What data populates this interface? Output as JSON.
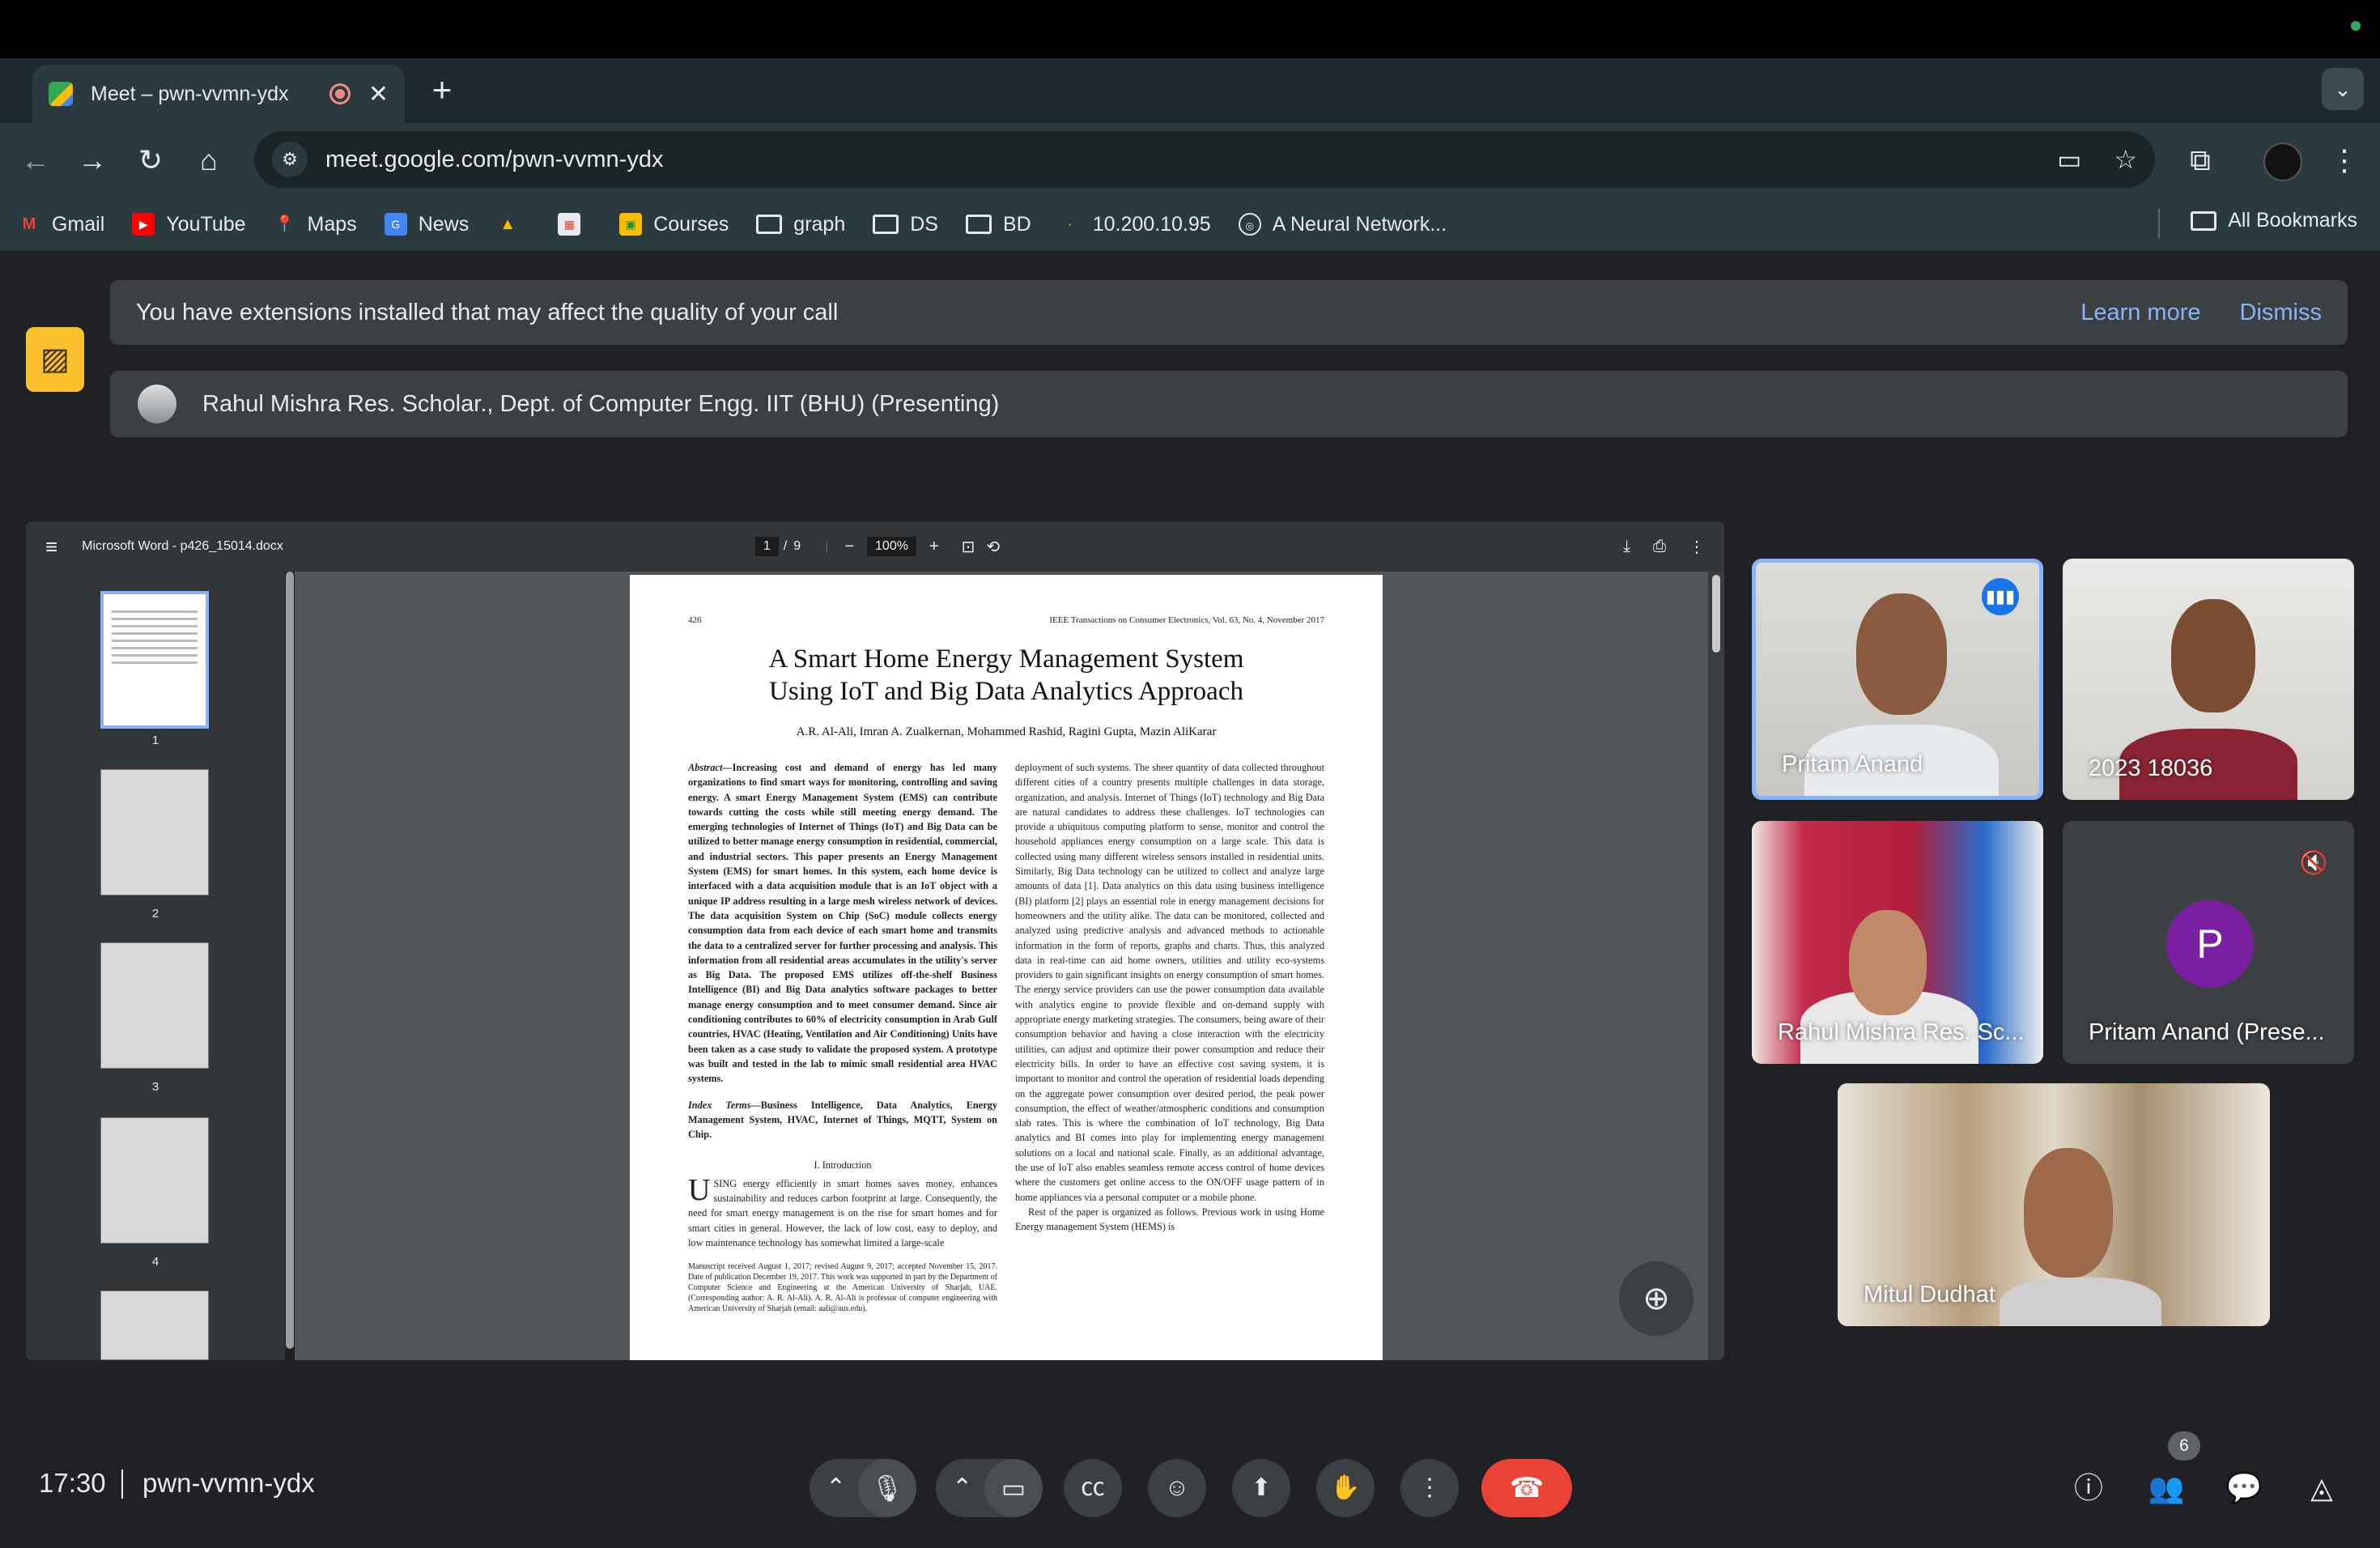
{
  "browser": {
    "tab_title": "Meet – pwn-vvmn-ydx",
    "url": "meet.google.com/pwn-vvmn-ydx",
    "bookmarks": [
      {
        "label": "Gmail",
        "icon": "gmail-icon"
      },
      {
        "label": "YouTube",
        "icon": "youtube-icon"
      },
      {
        "label": "Maps",
        "icon": "maps-icon"
      },
      {
        "label": "News",
        "icon": "news-icon"
      },
      {
        "label": "",
        "icon": "drive-icon"
      },
      {
        "label": "",
        "icon": "calendar-icon"
      },
      {
        "label": "Courses",
        "icon": "classroom-icon"
      },
      {
        "label": "graph",
        "icon": "folder-icon"
      },
      {
        "label": "DS",
        "icon": "folder-icon"
      },
      {
        "label": "BD",
        "icon": "folder-icon"
      },
      {
        "label": "10.200.10.95",
        "icon": "site-icon"
      },
      {
        "label": "A Neural Network...",
        "icon": "site-icon"
      }
    ],
    "all_bookmarks": "All Bookmarks"
  },
  "banners": {
    "extension_message": "You have extensions installed that may affect the quality of your call",
    "learn_more": "Learn more",
    "dismiss": "Dismiss",
    "presenting": "Rahul Mishra Res. Scholar., Dept. of Computer Engg. IIT (BHU) (Presenting)"
  },
  "pdf": {
    "file_title": "Microsoft Word - p426_15014.docx",
    "page_current": "1",
    "page_sep": "/",
    "page_total": "9",
    "zoom": "100%",
    "thumb_numbers": [
      "1",
      "2",
      "3",
      "4"
    ],
    "header_left": "426",
    "header_right": "IEEE Transactions on Consumer Electronics, Vol. 63, No. 4, November 2017",
    "title_line1": "A Smart Home Energy Management System",
    "title_line2": "Using IoT and Big Data Analytics Approach",
    "authors": "A.R. Al-Ali, Imran A. Zualkernan, Mohammed Rashid, Ragini Gupta, Mazin AliKarar",
    "abstract_label": "Abstract—",
    "abstract": "Increasing cost and demand of energy has led many organizations to find smart ways for monitoring, controlling and saving energy. A smart Energy Management System (EMS) can contribute towards cutting the costs while still meeting energy demand. The emerging technologies of Internet of Things (IoT) and Big Data can be utilized to better manage energy consumption in residential, commercial, and industrial sectors. This paper presents an Energy Management System (EMS) for smart homes. In this system, each home device is interfaced with a data acquisition module that is an IoT object with a unique IP address resulting in a large mesh wireless network of devices. The data acquisition System on Chip (SoC) module collects energy consumption data from each device of each smart home and transmits the data to a centralized server for further processing and analysis. This information from all residential areas accumulates in the utility's server as Big Data. The proposed EMS utilizes off-the-shelf Business Intelligence (BI) and Big Data analytics software packages to better manage energy consumption and to meet consumer demand. Since air conditioning contributes to 60% of electricity consumption in Arab Gulf countries, HVAC (Heating, Ventilation and Air Conditioning) Units have been taken as a case study to validate the proposed system. A prototype was built and tested in the lab to mimic small residential area HVAC systems.",
    "index_label": "Index Terms—",
    "index_terms": "Business Intelligence, Data Analytics, Energy Management System, HVAC, Internet of Things, MQTT, System on Chip.",
    "section_heading": "I. Introduction",
    "intro_dropcap": "U",
    "intro": "SING energy efficiently in smart homes saves money, enhances sustainability and reduces carbon footprint at large. Consequently, the need for smart energy management is on the rise for smart homes and for smart cities in general. However, the lack of low cost, easy to deploy, and low maintenance technology has somewhat limited a large-scale",
    "footnote": "Manuscript received August 1, 2017; revised August 9, 2017; accepted November 15, 2017. Date of publication December 19, 2017. This work was supported in part by the Department of Computer Science and Engineering at the American University of Sharjah, UAE. (Corresponding author: A. R. Al-Ali). A. R. Al-Ali is professor of computer engineering with American University of Sharjah (email: aali@aus.edu).",
    "col2": "deployment of such systems. The sheer quantity of data collected throughout different cities of a country presents multiple challenges in data storage, organization, and analysis. Internet of Things (IoT) technology and Big Data are natural candidates to address these challenges. IoT technologies can provide a ubiquitous computing platform to sense, monitor and control the household appliances energy consumption on a large scale. This data is collected using many different wireless sensors installed in residential units. Similarly, Big Data technology can be utilized to collect and analyze large amounts of data [1]. Data analytics on this data using business intelligence (BI) platform [2] plays an essential role in energy management decisions for homeowners and the utility alike. The data can be monitored, collected and analyzed using predictive analysis and advanced methods to actionable information in the form of reports, graphs and charts. Thus, this analyzed data in real-time can aid home owners, utilities and utility eco-systems providers to gain significant insights on energy consumption of smart homes. The energy service providers can use the power consumption data available with analytics engine to provide flexible and on-demand supply with appropriate energy marketing strategies. The consumers, being aware of their consumption behavior and having a close interaction with the electricity utilities, can adjust and optimize their power consumption and reduce their electricity bills. In order to have an effective cost saving system, it is important to monitor and control the operation of residential loads depending on the aggregate power consumption over desired period, the peak power consumption, the effect of weather/atmospheric conditions and consumption slab rates. This is where the combination of IoT technology, Big Data analytics and BI comes into play for implementing energy management solutions on a local and national scale. Finally, as an additional advantage, the use of IoT also enables seamless remote access control of home devices where the customers get online access to the ON/OFF usage pattern of in home appliances via a personal computer or a mobile phone.",
    "col2_last": "Rest of the paper is organized as follows. Previous work in using Home Energy management System (HEMS) is"
  },
  "participants": [
    {
      "name": "Pritam Anand"
    },
    {
      "name": "2023 18036"
    },
    {
      "name": "Rahul Mishra Res. Sc..."
    },
    {
      "name": "Pritam Anand (Prese...",
      "initial": "P",
      "avatar_color": "#7b1fa2"
    },
    {
      "name": "Mitul Dudhat"
    }
  ],
  "bottom": {
    "time": "17:30",
    "meeting_code": "pwn-vvmn-ydx",
    "participant_count": "6"
  },
  "colors": {
    "accent": "#8ab4f8",
    "leave": "#ea4335",
    "speaking": "#1a73e8",
    "warning": "#fbc02d"
  }
}
